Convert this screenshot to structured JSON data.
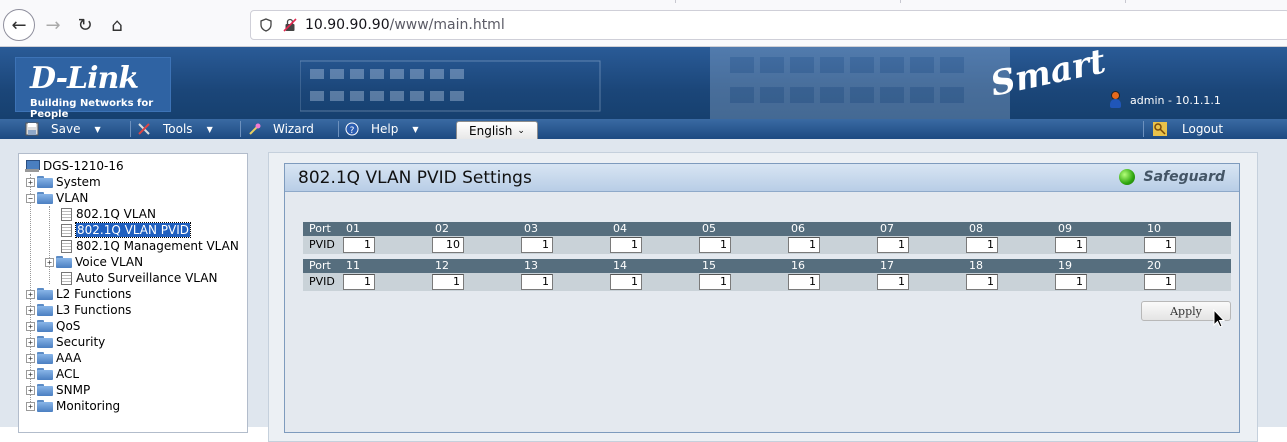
{
  "browser": {
    "url_host": "10.90.90.90",
    "url_path": "/www/main.html"
  },
  "header": {
    "logo_text": "D-Link",
    "logo_tagline": "Building Networks for People",
    "smart_logo": "Smart",
    "user_info": "admin - 10.1.1.1",
    "colors": {
      "header_bg": "#1b4679",
      "menu_bg": "#2a5b97"
    }
  },
  "menu": {
    "save_label": "Save",
    "tools_label": "Tools",
    "wizard_label": "Wizard",
    "help_label": "Help",
    "language_selected": "English",
    "logout_label": "Logout"
  },
  "tree": {
    "root": "DGS-1210-16",
    "system": "System",
    "vlan": "VLAN",
    "vlan_8021q": "802.1Q VLAN",
    "vlan_pvid": "802.1Q VLAN PVID",
    "vlan_mgmt": "802.1Q Management VLAN",
    "voice_vlan": "Voice VLAN",
    "auto_surv": "Auto Surveillance VLAN",
    "l2": "L2 Functions",
    "l3": "L3 Functions",
    "qos": "QoS",
    "security": "Security",
    "aaa": "AAA",
    "acl": "ACL",
    "snmp": "SNMP",
    "monitoring": "Monitoring",
    "selected_color": "#1f5fbf"
  },
  "settings": {
    "title": "802.1Q VLAN PVID Settings",
    "safeguard_label": "Safeguard",
    "port_label": "Port",
    "pvid_label": "PVID",
    "row1_ports": [
      "01",
      "02",
      "03",
      "04",
      "05",
      "06",
      "07",
      "08",
      "09",
      "10"
    ],
    "row1_pvids": [
      "1",
      "10",
      "1",
      "1",
      "1",
      "1",
      "1",
      "1",
      "1",
      "1"
    ],
    "row2_ports": [
      "11",
      "12",
      "13",
      "14",
      "15",
      "16",
      "17",
      "18",
      "19",
      "20"
    ],
    "row2_pvids": [
      "1",
      "1",
      "1",
      "1",
      "1",
      "1",
      "1",
      "1",
      "1",
      "1"
    ],
    "apply_label": "Apply"
  }
}
